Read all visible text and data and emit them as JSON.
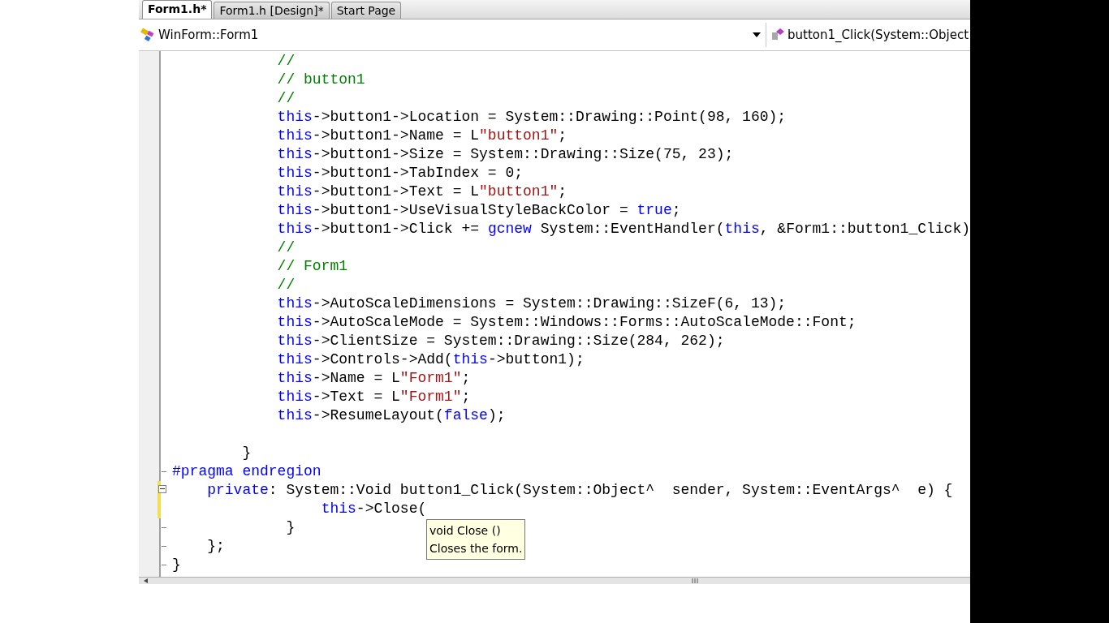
{
  "tabs": [
    {
      "label": "Form1.h*",
      "selected": true
    },
    {
      "label": "Form1.h [Design]*",
      "selected": false
    },
    {
      "label": "Start Page",
      "selected": false
    }
  ],
  "nav": {
    "class_selector": "WinForm::Form1",
    "member_selector": "button1_Click(System::Object"
  },
  "code_lines": [
    {
      "changed": false,
      "tokens": [
        {
          "text": "            //",
          "kind": "comment"
        }
      ]
    },
    {
      "changed": false,
      "tokens": [
        {
          "text": "            // button1",
          "kind": "comment"
        }
      ]
    },
    {
      "changed": false,
      "tokens": [
        {
          "text": "            //",
          "kind": "comment"
        }
      ]
    },
    {
      "changed": false,
      "tokens": [
        {
          "text": "            this",
          "kind": "keyword"
        },
        {
          "text": "->button1->Location = System::Drawing::Point(98, 160);",
          "kind": "plain"
        }
      ]
    },
    {
      "changed": false,
      "tokens": [
        {
          "text": "            this",
          "kind": "keyword"
        },
        {
          "text": "->button1->Name = L",
          "kind": "plain"
        },
        {
          "text": "\"button1\"",
          "kind": "string"
        },
        {
          "text": ";",
          "kind": "plain"
        }
      ]
    },
    {
      "changed": false,
      "tokens": [
        {
          "text": "            this",
          "kind": "keyword"
        },
        {
          "text": "->button1->Size = System::Drawing::Size(75, 23);",
          "kind": "plain"
        }
      ]
    },
    {
      "changed": false,
      "tokens": [
        {
          "text": "            this",
          "kind": "keyword"
        },
        {
          "text": "->button1->TabIndex = 0;",
          "kind": "plain"
        }
      ]
    },
    {
      "changed": false,
      "tokens": [
        {
          "text": "            this",
          "kind": "keyword"
        },
        {
          "text": "->button1->Text = L",
          "kind": "plain"
        },
        {
          "text": "\"button1\"",
          "kind": "string"
        },
        {
          "text": ";",
          "kind": "plain"
        }
      ]
    },
    {
      "changed": false,
      "tokens": [
        {
          "text": "            this",
          "kind": "keyword"
        },
        {
          "text": "->button1->UseVisualStyleBackColor = ",
          "kind": "plain"
        },
        {
          "text": "true",
          "kind": "keyword"
        },
        {
          "text": ";",
          "kind": "plain"
        }
      ]
    },
    {
      "changed": false,
      "tokens": [
        {
          "text": "            this",
          "kind": "keyword"
        },
        {
          "text": "->button1->Click += ",
          "kind": "plain"
        },
        {
          "text": "gcnew",
          "kind": "keyword"
        },
        {
          "text": " System::EventHandler(",
          "kind": "plain"
        },
        {
          "text": "this",
          "kind": "keyword"
        },
        {
          "text": ", &Form1::button1_Click)",
          "kind": "plain"
        }
      ]
    },
    {
      "changed": false,
      "tokens": [
        {
          "text": "            //",
          "kind": "comment"
        }
      ]
    },
    {
      "changed": false,
      "tokens": [
        {
          "text": "            // Form1",
          "kind": "comment"
        }
      ]
    },
    {
      "changed": false,
      "tokens": [
        {
          "text": "            //",
          "kind": "comment"
        }
      ]
    },
    {
      "changed": false,
      "tokens": [
        {
          "text": "            this",
          "kind": "keyword"
        },
        {
          "text": "->AutoScaleDimensions = System::Drawing::SizeF(6, 13);",
          "kind": "plain"
        }
      ]
    },
    {
      "changed": false,
      "tokens": [
        {
          "text": "            this",
          "kind": "keyword"
        },
        {
          "text": "->AutoScaleMode = System::Windows::Forms::AutoScaleMode::Font;",
          "kind": "plain"
        }
      ]
    },
    {
      "changed": false,
      "tokens": [
        {
          "text": "            this",
          "kind": "keyword"
        },
        {
          "text": "->ClientSize = System::Drawing::Size(284, 262);",
          "kind": "plain"
        }
      ]
    },
    {
      "changed": false,
      "tokens": [
        {
          "text": "            this",
          "kind": "keyword"
        },
        {
          "text": "->Controls->Add(",
          "kind": "plain"
        },
        {
          "text": "this",
          "kind": "keyword"
        },
        {
          "text": "->button1);",
          "kind": "plain"
        }
      ]
    },
    {
      "changed": false,
      "tokens": [
        {
          "text": "            this",
          "kind": "keyword"
        },
        {
          "text": "->Name = L",
          "kind": "plain"
        },
        {
          "text": "\"Form1\"",
          "kind": "string"
        },
        {
          "text": ";",
          "kind": "plain"
        }
      ]
    },
    {
      "changed": false,
      "tokens": [
        {
          "text": "            this",
          "kind": "keyword"
        },
        {
          "text": "->Text = L",
          "kind": "plain"
        },
        {
          "text": "\"Form1\"",
          "kind": "string"
        },
        {
          "text": ";",
          "kind": "plain"
        }
      ]
    },
    {
      "changed": false,
      "tokens": [
        {
          "text": "            this",
          "kind": "keyword"
        },
        {
          "text": "->ResumeLayout(",
          "kind": "plain"
        },
        {
          "text": "false",
          "kind": "keyword"
        },
        {
          "text": ");",
          "kind": "plain"
        }
      ]
    },
    {
      "changed": false
    },
    {
      "changed": false,
      "tokens": [
        {
          "text": "        }",
          "kind": "plain"
        }
      ]
    },
    {
      "gutter_mark": {
        "kind": "end"
      },
      "changed": false,
      "tokens": [
        {
          "text": "#pragma endregion",
          "kind": "keyword"
        }
      ]
    },
    {
      "gutter_mark": {
        "kind": "collapse"
      },
      "changed": true,
      "tokens": [
        {
          "text": "    private",
          "kind": "keyword"
        },
        {
          "text": ": System::Void button1_Click(System::Object^  sender, System::EventArgs^  e) {",
          "kind": "plain"
        }
      ]
    },
    {
      "changed": true,
      "tokens": [
        {
          "text": "                 this",
          "kind": "keyword"
        },
        {
          "text": "->Close(",
          "kind": "plain"
        }
      ]
    },
    {
      "gutter_mark": {
        "kind": "end"
      },
      "changed": false,
      "tokens": [
        {
          "text": "             }",
          "kind": "plain"
        }
      ]
    },
    {
      "gutter_mark": {
        "kind": "end"
      },
      "changed": false,
      "tokens": [
        {
          "text": "    };",
          "kind": "plain"
        }
      ]
    },
    {
      "gutter_mark": {
        "kind": "end"
      },
      "changed": false,
      "tokens": [
        {
          "text": "}",
          "kind": "plain"
        }
      ]
    }
  ],
  "tooltip": {
    "signature": "void Close ()",
    "description": "Closes the form."
  }
}
